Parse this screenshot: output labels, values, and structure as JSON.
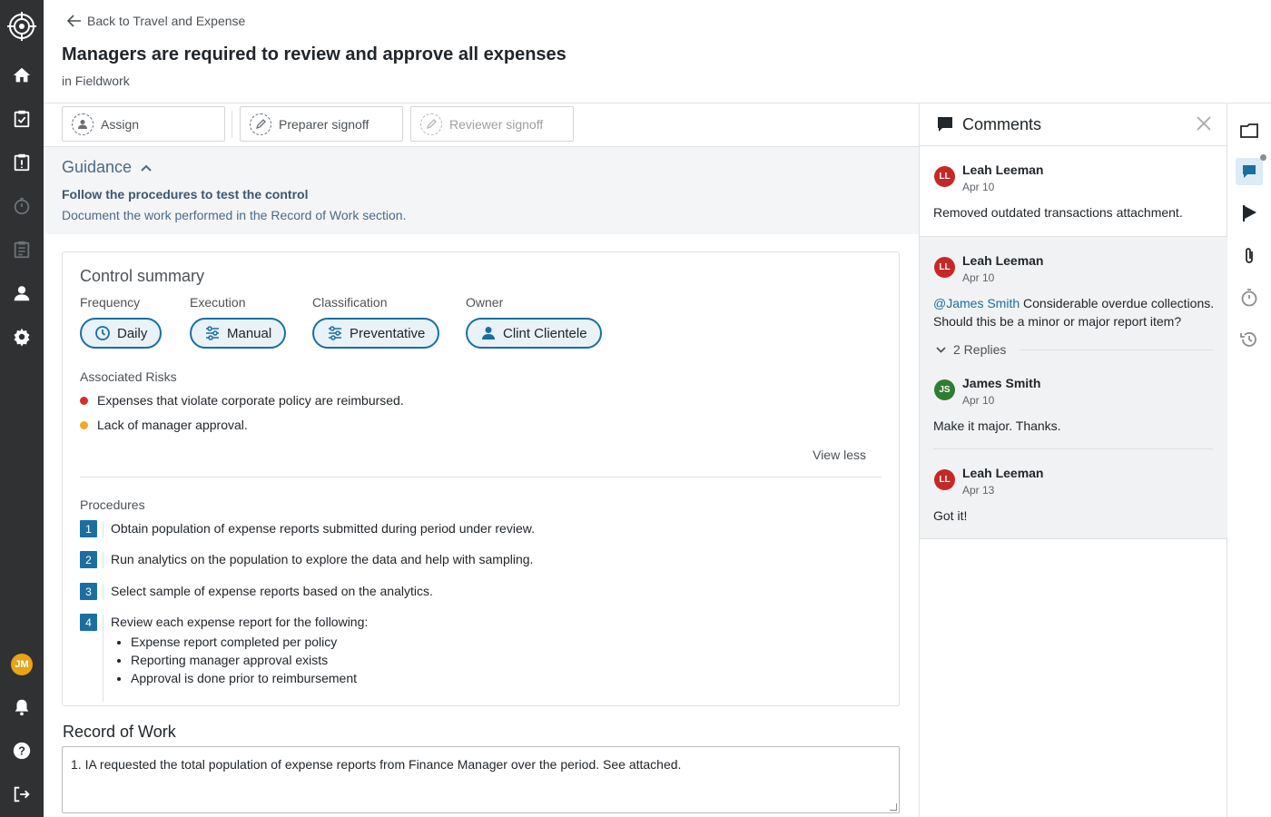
{
  "nav": {
    "user_initials": "JM"
  },
  "header": {
    "back_label": "Back to Travel and Expense",
    "title": "Managers are required to review and approve all expenses",
    "breadcrumb": "in Fieldwork"
  },
  "toolbar": {
    "assign_label": "Assign",
    "preparer_label": "Preparer signoff",
    "reviewer_label": "Reviewer signoff"
  },
  "guidance": {
    "title": "Guidance",
    "bold": "Follow the procedures to test the control",
    "text": "Document the work performed in the Record of Work section."
  },
  "control_summary": {
    "title": "Control summary",
    "frequency_label": "Frequency",
    "frequency": "Daily",
    "execution_label": "Execution",
    "execution": "Manual",
    "classification_label": "Classification",
    "classification": "Preventative",
    "owner_label": "Owner",
    "owner": "Clint Clientele",
    "risks_label": "Associated Risks",
    "risks": [
      {
        "text": "Expenses that violate corporate policy are reimbursed.",
        "color": "#d32f2f"
      },
      {
        "text": "Lack of manager approval.",
        "color": "#f5a623"
      }
    ],
    "view_less": "View less",
    "procedures_label": "Procedures",
    "procedures": [
      {
        "num": "1",
        "text": "Obtain population of expense reports submitted during period under review."
      },
      {
        "num": "2",
        "text": "Run analytics on the population to explore the data and help with sampling."
      },
      {
        "num": "3",
        "text": "Select sample of expense reports based on the analytics."
      },
      {
        "num": "4",
        "text": "Review each expense report for the following:",
        "bullets": [
          "Expense report completed per policy",
          "Reporting manager approval exists",
          "Approval is done prior to reimbursement"
        ]
      }
    ]
  },
  "record_of_work": {
    "title": "Record of Work",
    "value": "1. IA requested the total population of expense reports from Finance Manager over the period. See attached."
  },
  "comments": {
    "title": "Comments",
    "items": [
      {
        "initials": "LL",
        "avatar_color": "#c62828",
        "name": "Leah Leeman",
        "date": "Apr 10",
        "text": "Removed outdated transactions attachment."
      },
      {
        "initials": "LL",
        "avatar_color": "#c62828",
        "name": "Leah Leeman",
        "date": "Apr 10",
        "mention": "@James Smith",
        "text": " Considerable overdue collections. Should this be a minor or major report item?"
      },
      {
        "initials": "JS",
        "avatar_color": "#2e7d32",
        "name": "James Smith",
        "date": "Apr 10",
        "text": "Make it major. Thanks."
      },
      {
        "initials": "LL",
        "avatar_color": "#c62828",
        "name": "Leah Leeman",
        "date": "Apr 13",
        "text": "Got it!"
      }
    ],
    "replies_label": "2 Replies"
  },
  "colors": {
    "nav_bg": "#2f3133",
    "accent": "#1a6fa0"
  }
}
